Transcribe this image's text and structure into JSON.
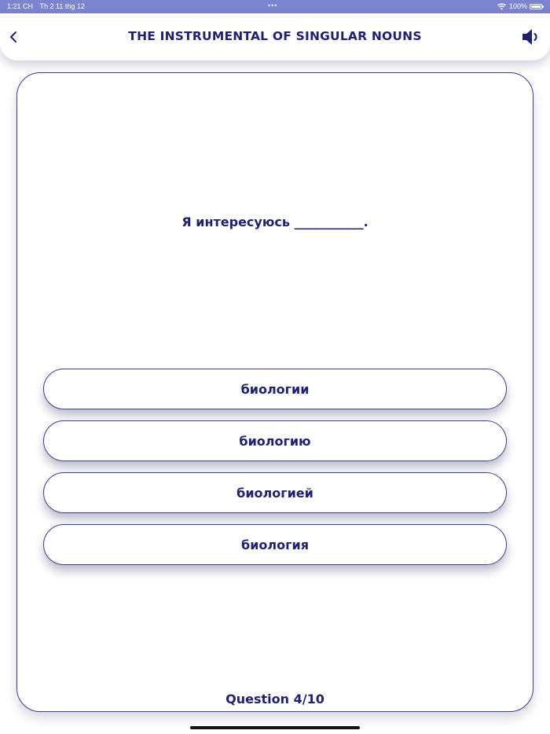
{
  "status_bar": {
    "time": "1:21 CH",
    "date": "Th 2 11 thg 12",
    "dots": "•••",
    "battery_percent": "100%",
    "battery_level": 1.0,
    "icons": [
      "wifi-icon",
      "battery-icon"
    ]
  },
  "header": {
    "title": "THE INSTRUMENTAL OF SINGULAR NOUNS",
    "back_icon": "chevron-left-icon",
    "speaker_icon": "speaker-icon"
  },
  "quiz": {
    "question": "Я интересуюсь ___________.",
    "answers": [
      {
        "label": "биологии"
      },
      {
        "label": "биологию"
      },
      {
        "label": "биологией"
      },
      {
        "label": "биология"
      }
    ],
    "progress": "Question 4/10",
    "current_question": 4,
    "total_questions": 10
  },
  "colors": {
    "accent": "#1f2170",
    "status_bar": "#7b84cf",
    "border": "#3b3d8f",
    "background": "#ffffff"
  }
}
